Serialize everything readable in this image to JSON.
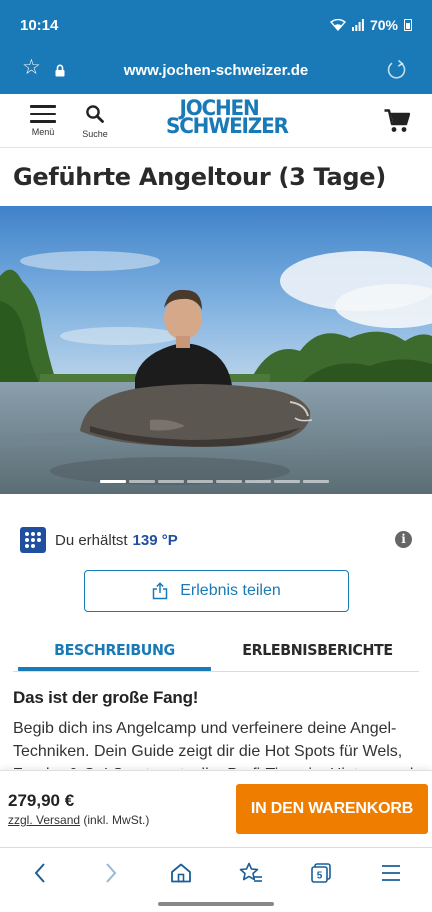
{
  "status": {
    "time": "10:14",
    "battery": "70%"
  },
  "browser": {
    "url": "www.jochen-schweizer.de"
  },
  "header": {
    "menu_label": "Menü",
    "search_label": "Suche",
    "logo_line1": "JOCHEN",
    "logo_line2": "SCHWEIZER"
  },
  "product": {
    "title": "Geführte Angeltour (3 Tage)",
    "gallery": {
      "slide_count": 8,
      "active_slide": 1
    }
  },
  "points": {
    "text": "Du erhältst",
    "value": "139 °P"
  },
  "share": {
    "label": "Erlebnis teilen"
  },
  "tabs": [
    {
      "label": "BESCHREIBUNG",
      "active": true
    },
    {
      "label": "ERLEBNISBERICHTE",
      "active": false
    }
  ],
  "description": {
    "heading": "Das ist der große Fang!",
    "text": "Begib dich ins Angelcamp und verfeinere deine Angel-Techniken. Dein Guide zeigt dir die Hot Spots für Wels, Zander & Co! Samt wertvoller Profi-Tipps im Hintergrund"
  },
  "buy": {
    "price": "279,90 €",
    "shipping_link": "zzgl. Versand",
    "shipping_suffix": "(inkl. MwSt.)",
    "cta": "IN DEN WARENKORB"
  },
  "nav": {
    "tab_count": "5"
  },
  "colors": {
    "brand_blue": "#1a7ab8",
    "cta_orange": "#ef7d00",
    "points_blue": "#1f4f9e"
  }
}
